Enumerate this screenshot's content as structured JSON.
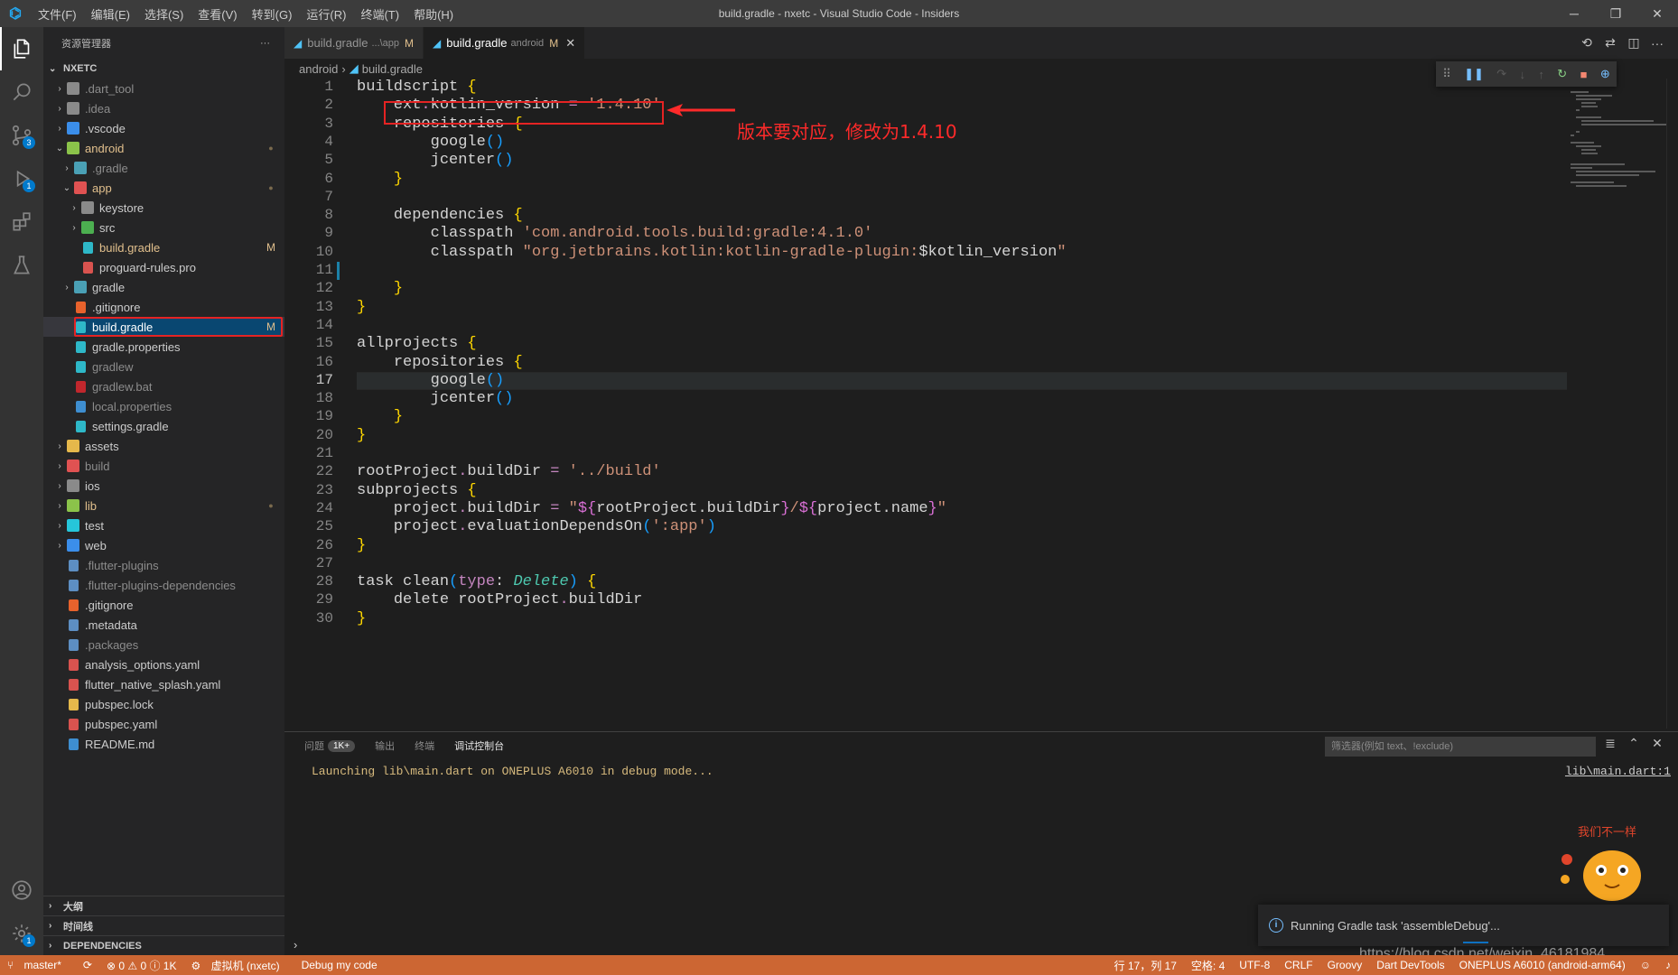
{
  "titlebar": {
    "menu": [
      "文件(F)",
      "编辑(E)",
      "选择(S)",
      "查看(V)",
      "转到(G)",
      "运行(R)",
      "终端(T)",
      "帮助(H)"
    ],
    "title": "build.gradle - nxetc - Visual Studio Code - Insiders"
  },
  "activity": {
    "scm_badge": "3",
    "debug_badge": "1",
    "settings_badge": "1"
  },
  "sidebar": {
    "header": "资源管理器",
    "more": "···",
    "root": "NXETC",
    "tree": [
      {
        "label": ".dart_tool",
        "depth": 0,
        "chev": "›",
        "icon": "#8a8a8a",
        "cls": "ignored"
      },
      {
        "label": ".idea",
        "depth": 0,
        "chev": "›",
        "icon": "#8a8a8a",
        "cls": "ignored"
      },
      {
        "label": ".vscode",
        "depth": 0,
        "chev": "›",
        "icon": "#3b8eea",
        "cls": ""
      },
      {
        "label": "android",
        "depth": 0,
        "chev": "⌄",
        "icon": "#8bc34a",
        "cls": "modified",
        "dot": "●"
      },
      {
        "label": ".gradle",
        "depth": 1,
        "chev": "›",
        "icon": "#4aa0b5",
        "cls": "ignored"
      },
      {
        "label": "app",
        "depth": 1,
        "chev": "⌄",
        "icon": "#e05252",
        "cls": "modified",
        "dot": "●"
      },
      {
        "label": "keystore",
        "depth": 2,
        "chev": "›",
        "icon": "#8a8a8a",
        "cls": ""
      },
      {
        "label": "src",
        "depth": 2,
        "chev": "›",
        "icon": "#4caf50",
        "cls": ""
      },
      {
        "label": "build.gradle",
        "depth": 2,
        "chev": "",
        "icon": "#2eb8c8",
        "cls": "modified",
        "stat": "M"
      },
      {
        "label": "proguard-rules.pro",
        "depth": 2,
        "chev": "",
        "icon": "#d9534f",
        "cls": ""
      },
      {
        "label": "gradle",
        "depth": 1,
        "chev": "›",
        "icon": "#4aa0b5",
        "cls": ""
      },
      {
        "label": ".gitignore",
        "depth": 1,
        "chev": "",
        "icon": "#e8622c",
        "cls": ""
      },
      {
        "label": "build.gradle",
        "depth": 1,
        "chev": "",
        "icon": "#2eb8c8",
        "cls": "modified",
        "stat": "M",
        "selected": true
      },
      {
        "label": "gradle.properties",
        "depth": 1,
        "chev": "",
        "icon": "#2eb8c8",
        "cls": ""
      },
      {
        "label": "gradlew",
        "depth": 1,
        "chev": "",
        "icon": "#2eb8c8",
        "cls": "ignored"
      },
      {
        "label": "gradlew.bat",
        "depth": 1,
        "chev": "",
        "icon": "#c1272d",
        "cls": "ignored"
      },
      {
        "label": "local.properties",
        "depth": 1,
        "chev": "",
        "icon": "#3e8ed0",
        "cls": "ignored"
      },
      {
        "label": "settings.gradle",
        "depth": 1,
        "chev": "",
        "icon": "#2eb8c8",
        "cls": ""
      },
      {
        "label": "assets",
        "depth": 0,
        "chev": "›",
        "icon": "#e5b84b",
        "cls": ""
      },
      {
        "label": "build",
        "depth": 0,
        "chev": "›",
        "icon": "#e05252",
        "cls": "ignored"
      },
      {
        "label": "ios",
        "depth": 0,
        "chev": "›",
        "icon": "#8a8a8a",
        "cls": ""
      },
      {
        "label": "lib",
        "depth": 0,
        "chev": "›",
        "icon": "#8bc34a",
        "cls": "modified",
        "dot": "●"
      },
      {
        "label": "test",
        "depth": 0,
        "chev": "›",
        "icon": "#26c6da",
        "cls": ""
      },
      {
        "label": "web",
        "depth": 0,
        "chev": "›",
        "icon": "#3b8eea",
        "cls": ""
      },
      {
        "label": ".flutter-plugins",
        "depth": 0,
        "chev": "",
        "icon": "#5d8ec2",
        "cls": "ignored"
      },
      {
        "label": ".flutter-plugins-dependencies",
        "depth": 0,
        "chev": "",
        "icon": "#5d8ec2",
        "cls": "ignored"
      },
      {
        "label": ".gitignore",
        "depth": 0,
        "chev": "",
        "icon": "#e8622c",
        "cls": ""
      },
      {
        "label": ".metadata",
        "depth": 0,
        "chev": "",
        "icon": "#5d8ec2",
        "cls": ""
      },
      {
        "label": ".packages",
        "depth": 0,
        "chev": "",
        "icon": "#5d8ec2",
        "cls": "ignored"
      },
      {
        "label": "analysis_options.yaml",
        "depth": 0,
        "chev": "",
        "icon": "#d9534f",
        "cls": ""
      },
      {
        "label": "flutter_native_splash.yaml",
        "depth": 0,
        "chev": "",
        "icon": "#d9534f",
        "cls": ""
      },
      {
        "label": "pubspec.lock",
        "depth": 0,
        "chev": "",
        "icon": "#e5b84b",
        "cls": ""
      },
      {
        "label": "pubspec.yaml",
        "depth": 0,
        "chev": "",
        "icon": "#d9534f",
        "cls": ""
      },
      {
        "label": "README.md",
        "depth": 0,
        "chev": "",
        "icon": "#3e8ed0",
        "cls": ""
      }
    ],
    "bottom_sections": [
      "大纲",
      "时间线",
      "DEPENDENCIES"
    ]
  },
  "tabs": [
    {
      "label": "build.gradle",
      "desc": "...\\app",
      "mark": "M",
      "active": false
    },
    {
      "label": "build.gradle",
      "desc": "android",
      "mark": "M",
      "close": "✕",
      "active": true
    }
  ],
  "breadcrumbs": [
    "android",
    "build.gradle"
  ],
  "code": {
    "current_line": 17,
    "lines": [
      "buildscript {",
      "    ext.kotlin_version = '1.4.10'",
      "    repositories {",
      "        google()",
      "        jcenter()",
      "    }",
      "",
      "    dependencies {",
      "        classpath 'com.android.tools.build:gradle:4.1.0'",
      "        classpath \"org.jetbrains.kotlin:kotlin-gradle-plugin:$kotlin_version\"",
      "",
      "    }",
      "}",
      "",
      "allprojects {",
      "    repositories {",
      "        google()",
      "        jcenter()",
      "    }",
      "}",
      "",
      "rootProject.buildDir = '../build'",
      "subprojects {",
      "    project.buildDir = \"${rootProject.buildDir}/${project.name}\"",
      "    project.evaluationDependsOn(':app')",
      "}",
      "",
      "task clean(type: Delete) {",
      "    delete rootProject.buildDir",
      "}"
    ]
  },
  "annotation": "版本要对应，修改为1.4.10",
  "panel": {
    "tabs": [
      "问题",
      "输出",
      "终端",
      "调试控制台"
    ],
    "problems_count": "1K+",
    "filter_placeholder": "筛选器(例如 text、!exclude)",
    "console": "Launching lib\\main.dart on ONEPLUS A6010 in debug mode...",
    "console_link": "lib\\main.dart:1",
    "prompt": "›"
  },
  "notification": {
    "text": "Running Gradle task 'assembleDebug'...",
    "icon": "i"
  },
  "mascot_text": "我们不一样",
  "statusbar": {
    "branch": "master*",
    "sync": "⟳",
    "problems": "⊗ 0 ⚠ 0 ⓘ 1K",
    "device": "虚拟机 (nxetc)",
    "debug_mode": "Debug my code",
    "position": "行 17，列 17",
    "spaces": "空格: 4",
    "encoding": "UTF-8",
    "eol": "CRLF",
    "language": "Groovy",
    "devtools": "Dart DevTools",
    "target": "ONEPLUS A6010 (android-arm64)"
  },
  "watermark": "https://blog.csdn.net/weixin_46181984"
}
